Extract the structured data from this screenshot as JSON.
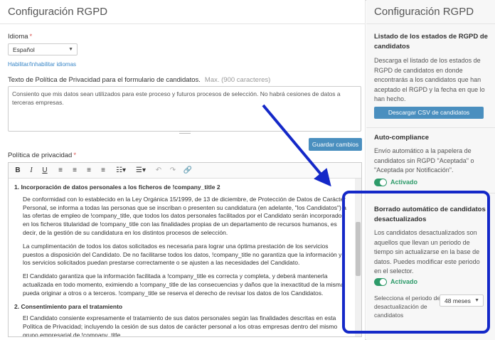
{
  "left": {
    "title": "Configuración RGPD",
    "language": {
      "label": "Idioma",
      "required_mark": "*",
      "value": "Español"
    },
    "enable_languages_link": "Habilitar/Inhabilitar idiomas",
    "privacy_form_text": {
      "label": "Texto de Política de Privacidad para el formulario de candidatos.",
      "hint": "Max. (900 caracteres)",
      "value": "Consiento que mis datos sean utilizados para este proceso y futuros procesos de selección. No habrá cesiones de datos a terceras empresas."
    },
    "save_button": "Guardar cambios",
    "privacy_policy": {
      "label": "Política de privacidad",
      "required_mark": "*",
      "sections": [
        {
          "heading": "1. Incorporación de datos personales a los ficheros de !company_title 2",
          "paragraphs": [
            "De conformidad con lo establecido en la Ley Orgánica 15/1999, de 13 de diciembre, de Protección de Datos de Carácter Personal, se informa a todas las personas que se inscriban o presenten su candidatura (en adelante, \"los Candidatos\") a las ofertas de empleo de !company_title, que todos los datos personales facilitados por el Candidato serán incorporados en los ficheros titularidad de !company_title con las finalidades propias de un departamento de recursos humanos, es decir, de la gestión de su candidatura en los distintos procesos de selección.",
            "La cumplimentación de todos los datos solicitados es necesaria para lograr una óptima prestación de los servicios puestos a disposición del Candidato. De no facilitarse todos los datos, !company_title no garantiza que la información y los servicios solicitados puedan prestarse correctamente o se ajusten a las necesidades del Candidato.",
            "El Candidato garantiza que la información facilitada a !company_title es correcta y completa, y deberá mantenerla actualizada en todo momento, eximiendo a !company_title de las consecuencias y daños que la inexactitud de la misma pueda originar a otros o a terceros. !company_title se reserva el derecho de revisar los datos de los Candidatos."
          ]
        },
        {
          "heading": "2. Consentimiento para el tratamiento",
          "paragraphs": [
            "El Candidato consiente expresamente el tratamiento de sus datos personales según las finalidades descritas en esta Política de Privacidad; incluyendo la cesión de sus datos de carácter personal a los otras empresas dentro del mismo grupo empresarial de !company_title."
          ]
        }
      ]
    }
  },
  "right": {
    "title": "Configuración RGPD",
    "csv_section": {
      "heading": "Listado de los estados de RGPD de candidatos",
      "text": "Descarga el listado de los estados de RGPD de candidatos en donde encontrarás a los candidatos que han aceptado el RGPD y la fecha en que lo han hecho.",
      "button": "Descargar CSV de candidatos"
    },
    "auto_compliance": {
      "heading": "Auto-compliance",
      "text": "Envío automático a la papelera de candidatos sin RGPD \"Aceptada\" o \"Aceptada por Notificación\".",
      "toggle_label": "Activado"
    },
    "auto_delete": {
      "heading": "Borrado automático de candidatos desactualizados",
      "text": "Los candidatos desactualizados son aquellos que llevan un periodo de tiempo sin actualizarse en la base de datos. Puedes modificar este periodo en el selector.",
      "toggle_label": "Activado",
      "period_label": "Selecciona el periodo de desactualización de candidatos",
      "period_value": "48 meses"
    }
  },
  "colors": {
    "accent": "#4a8fbf",
    "active": "#2e9b6a",
    "highlight": "#1428c8"
  }
}
